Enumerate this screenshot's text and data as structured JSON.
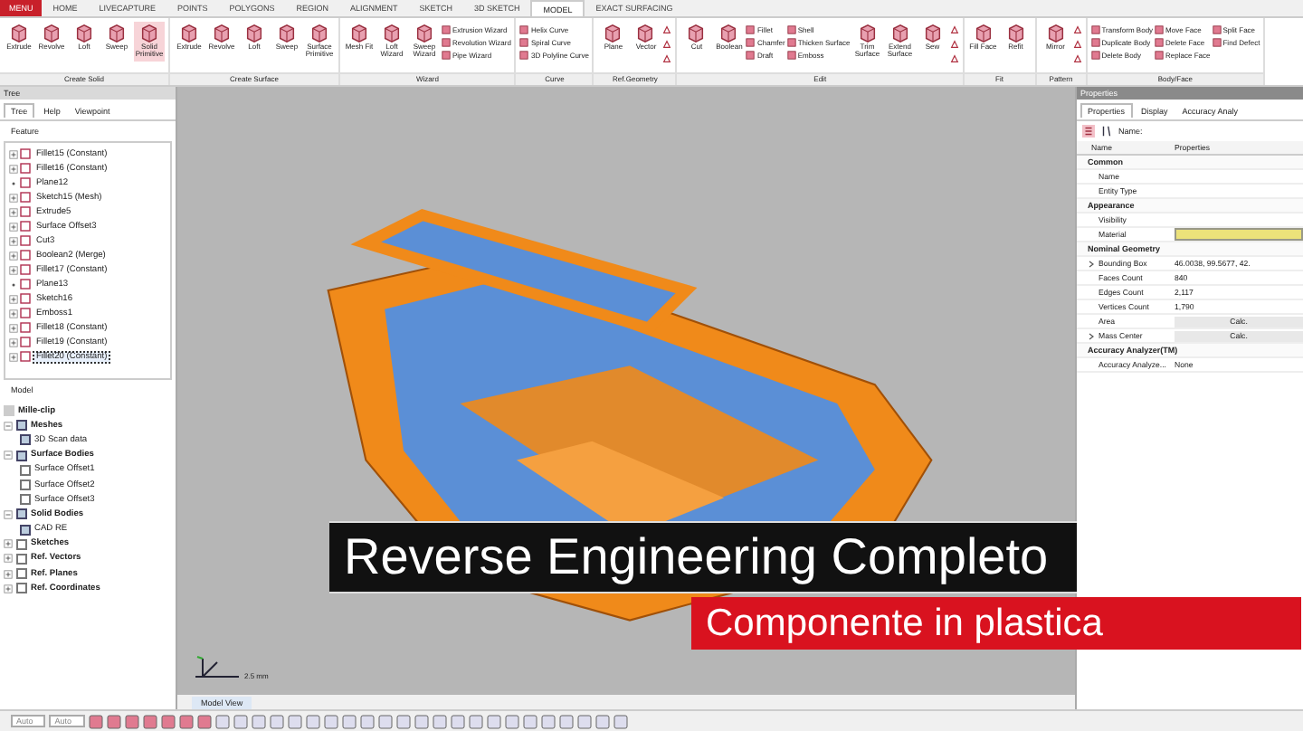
{
  "menu_button": "MENU",
  "tabs": [
    {
      "label": "HOME",
      "selected": false
    },
    {
      "label": "LIVECAPTURE",
      "selected": false
    },
    {
      "label": "POINTS",
      "selected": false
    },
    {
      "label": "POLYGONS",
      "selected": false
    },
    {
      "label": "REGION",
      "selected": false
    },
    {
      "label": "ALIGNMENT",
      "selected": false
    },
    {
      "label": "SKETCH",
      "selected": false
    },
    {
      "label": "3D SKETCH",
      "selected": false
    },
    {
      "label": "MODEL",
      "selected": true
    },
    {
      "label": "EXACT SURFACING",
      "selected": false
    }
  ],
  "ribbon_groups": [
    {
      "label": "Create Solid",
      "items": [
        {
          "kind": "large",
          "label": "Extrude",
          "selected": false
        },
        {
          "kind": "large",
          "label": "Revolve",
          "selected": false
        },
        {
          "kind": "large",
          "label": "Loft",
          "selected": false
        },
        {
          "kind": "large",
          "label": "Sweep",
          "selected": false
        },
        {
          "kind": "large",
          "label": "Solid Primitive",
          "selected": true
        }
      ]
    },
    {
      "label": "Create Surface",
      "items": [
        {
          "kind": "large",
          "label": "Extrude",
          "selected": false
        },
        {
          "kind": "large",
          "label": "Revolve",
          "selected": false
        },
        {
          "kind": "large",
          "label": "Loft",
          "selected": false
        },
        {
          "kind": "large",
          "label": "Sweep",
          "selected": false
        },
        {
          "kind": "large",
          "label": "Surface Primitive",
          "selected": false
        }
      ]
    },
    {
      "label": "Wizard",
      "items": [
        {
          "kind": "large",
          "label": "Mesh Fit",
          "selected": false
        },
        {
          "kind": "large",
          "label": "Loft Wizard",
          "selected": false
        },
        {
          "kind": "large",
          "label": "Sweep Wizard",
          "selected": false
        },
        {
          "kind": "stack",
          "labels": [
            "Extrusion Wizard",
            "Revolution Wizard",
            "Pipe Wizard"
          ]
        }
      ]
    },
    {
      "label": "Curve",
      "items": [
        {
          "kind": "stack",
          "labels": [
            "Helix Curve",
            "Spiral Curve",
            "3D Polyline Curve"
          ]
        }
      ]
    },
    {
      "label": "Ref.Geometry",
      "items": [
        {
          "kind": "large",
          "label": "Plane",
          "selected": false
        },
        {
          "kind": "large",
          "label": "Vector",
          "selected": false
        },
        {
          "kind": "icons"
        }
      ]
    },
    {
      "label": "Edit",
      "items": [
        {
          "kind": "large",
          "label": "Cut",
          "selected": false
        },
        {
          "kind": "large",
          "label": "Boolean",
          "selected": false
        },
        {
          "kind": "stack",
          "labels": [
            "Fillet",
            "Chamfer",
            "Draft"
          ]
        },
        {
          "kind": "stack",
          "labels": [
            "Shell",
            "Thicken Surface",
            "Emboss"
          ]
        },
        {
          "kind": "large",
          "label": "Trim Surface",
          "selected": false
        },
        {
          "kind": "large",
          "label": "Extend Surface",
          "selected": false
        },
        {
          "kind": "large",
          "label": "Sew",
          "selected": false
        },
        {
          "kind": "icons"
        }
      ]
    },
    {
      "label": "Fit",
      "items": [
        {
          "kind": "large",
          "label": "Fill Face",
          "selected": false
        },
        {
          "kind": "large",
          "label": "Refit",
          "selected": false
        }
      ]
    },
    {
      "label": "Pattern",
      "items": [
        {
          "kind": "large",
          "label": "Mirror",
          "selected": false
        },
        {
          "kind": "icons"
        }
      ]
    },
    {
      "label": "Body/Face",
      "items": [
        {
          "kind": "stack",
          "labels": [
            "Transform Body",
            "Duplicate Body",
            "Delete Body"
          ]
        },
        {
          "kind": "stack",
          "labels": [
            "Move Face",
            "Delete Face",
            "Replace Face"
          ]
        },
        {
          "kind": "stack",
          "labels": [
            "Split Face",
            "Find Defect"
          ]
        }
      ]
    }
  ],
  "tree_panel": {
    "title": "Tree",
    "tabs": [
      {
        "label": "Tree",
        "selected": true
      },
      {
        "label": "Help",
        "selected": false
      },
      {
        "label": "Viewpoint",
        "selected": false
      }
    ],
    "feature_header": "Feature",
    "features": [
      {
        "label": "Fillet15 (Constant)",
        "expandable": true,
        "selected": false
      },
      {
        "label": "Fillet16 (Constant)",
        "expandable": true,
        "selected": false
      },
      {
        "label": "Plane12",
        "expandable": false,
        "selected": false
      },
      {
        "label": "Sketch15 (Mesh)",
        "expandable": true,
        "selected": false
      },
      {
        "label": "Extrude5",
        "expandable": true,
        "selected": false
      },
      {
        "label": "Surface Offset3",
        "expandable": true,
        "selected": false
      },
      {
        "label": "Cut3",
        "expandable": true,
        "selected": false
      },
      {
        "label": "Boolean2 (Merge)",
        "expandable": true,
        "selected": false
      },
      {
        "label": "Fillet17 (Constant)",
        "expandable": true,
        "selected": false
      },
      {
        "label": "Plane13",
        "expandable": false,
        "selected": false
      },
      {
        "label": "Sketch16",
        "expandable": true,
        "selected": false
      },
      {
        "label": "Emboss1",
        "expandable": true,
        "selected": false
      },
      {
        "label": "Fillet18 (Constant)",
        "expandable": true,
        "selected": false
      },
      {
        "label": "Fillet19 (Constant)",
        "expandable": true,
        "selected": false
      },
      {
        "label": "Fillet20 (Constant)",
        "expandable": true,
        "selected": true
      }
    ],
    "model_header": "Model",
    "model_root": "Mille-clip",
    "model_tree": [
      {
        "label": "Meshes",
        "checked": true,
        "expanded": true,
        "children": [
          {
            "label": "3D Scan data",
            "checked": true
          }
        ]
      },
      {
        "label": "Surface Bodies",
        "checked": true,
        "expanded": true,
        "children": [
          {
            "label": "Surface Offset1",
            "checked": false
          },
          {
            "label": "Surface Offset2",
            "checked": false
          },
          {
            "label": "Surface Offset3",
            "checked": false
          }
        ]
      },
      {
        "label": "Solid Bodies",
        "checked": true,
        "expanded": true,
        "children": [
          {
            "label": "CAD RE",
            "checked": true
          }
        ]
      },
      {
        "label": "Sketches",
        "checked": false,
        "expanded": false
      },
      {
        "label": "Ref. Vectors",
        "checked": false,
        "expanded": false
      },
      {
        "label": "Ref. Planes",
        "checked": false,
        "expanded": false
      },
      {
        "label": "Ref. Coordinates",
        "checked": false,
        "expanded": false
      }
    ]
  },
  "viewport": {
    "scale": "2.5 mm",
    "view_tab": "Model View",
    "title": "Reverse Engineering Completo",
    "subtitle": "Componente in plastica"
  },
  "properties": {
    "title": "Properties",
    "tabs": [
      {
        "label": "Properties",
        "selected": true
      },
      {
        "label": "Display",
        "selected": false
      },
      {
        "label": "Accuracy Analy",
        "selected": false
      }
    ],
    "sort_label": "Name:",
    "columns": [
      "Name",
      "Properties"
    ],
    "groups": [
      {
        "label": "Common",
        "rows": [
          {
            "name": "Name",
            "kind": "text"
          },
          {
            "name": "Entity Type",
            "kind": "text"
          }
        ]
      },
      {
        "label": "Appearance",
        "rows": [
          {
            "name": "Visibility",
            "kind": "text"
          },
          {
            "name": "Material",
            "kind": "swatch",
            "color": "#ece27a"
          }
        ]
      },
      {
        "label": "Nominal Geometry",
        "rows": [
          {
            "name": "Bounding Box",
            "kind": "text",
            "value": "46.0038, 99.5677, 42.",
            "expandable": true
          },
          {
            "name": "Faces Count",
            "kind": "text",
            "value": "840"
          },
          {
            "name": "Edges Count",
            "kind": "text",
            "value": "2,117"
          },
          {
            "name": "Vertices Count",
            "kind": "text",
            "value": "1,790"
          },
          {
            "name": "Area",
            "kind": "button",
            "value": "Calc."
          },
          {
            "name": "Mass Center",
            "kind": "button",
            "value": "Calc.",
            "expandable": true
          }
        ]
      },
      {
        "label": "Accuracy Analyzer(TM)",
        "rows": [
          {
            "name": "Accuracy Analyze...",
            "kind": "text",
            "value": "None"
          }
        ]
      }
    ]
  },
  "bottom_toolbar": {
    "dropdowns": [
      "Auto",
      "Auto"
    ]
  }
}
